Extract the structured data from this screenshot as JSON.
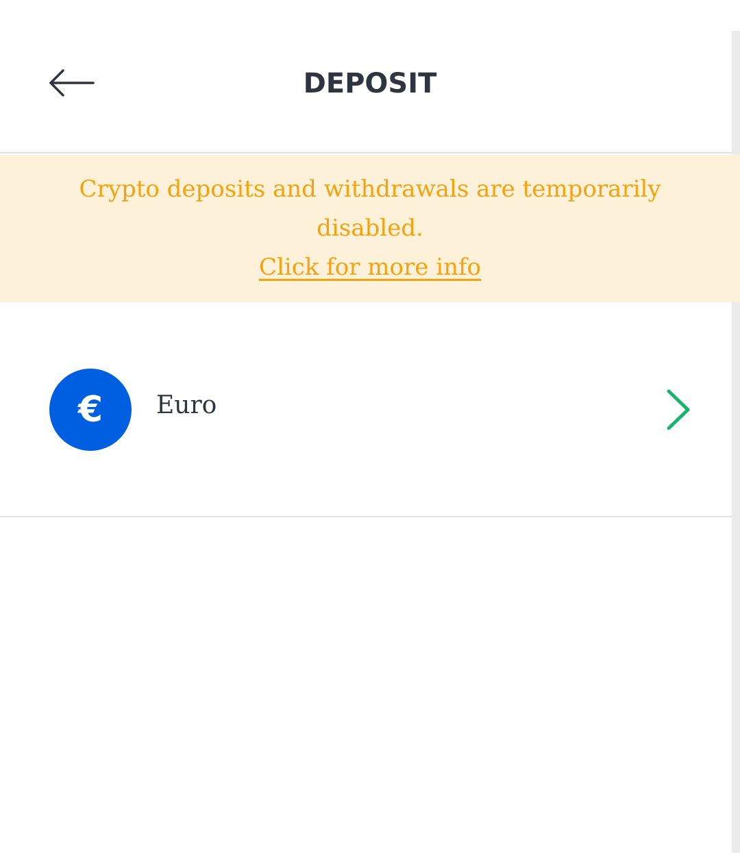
{
  "header": {
    "title": "DEPOSIT",
    "back_icon": "arrow-left-icon"
  },
  "notice": {
    "message": "Crypto deposits and withdrawals are temporarily disabled.",
    "link_label": "Click for more info",
    "background_color": "#fef1da",
    "text_color": "#f4a30f"
  },
  "currencies": [
    {
      "name": "Euro",
      "symbol": "€",
      "icon_color": "#005fe0",
      "chevron_icon": "chevron-right-icon",
      "chevron_color": "#19b46c"
    }
  ]
}
